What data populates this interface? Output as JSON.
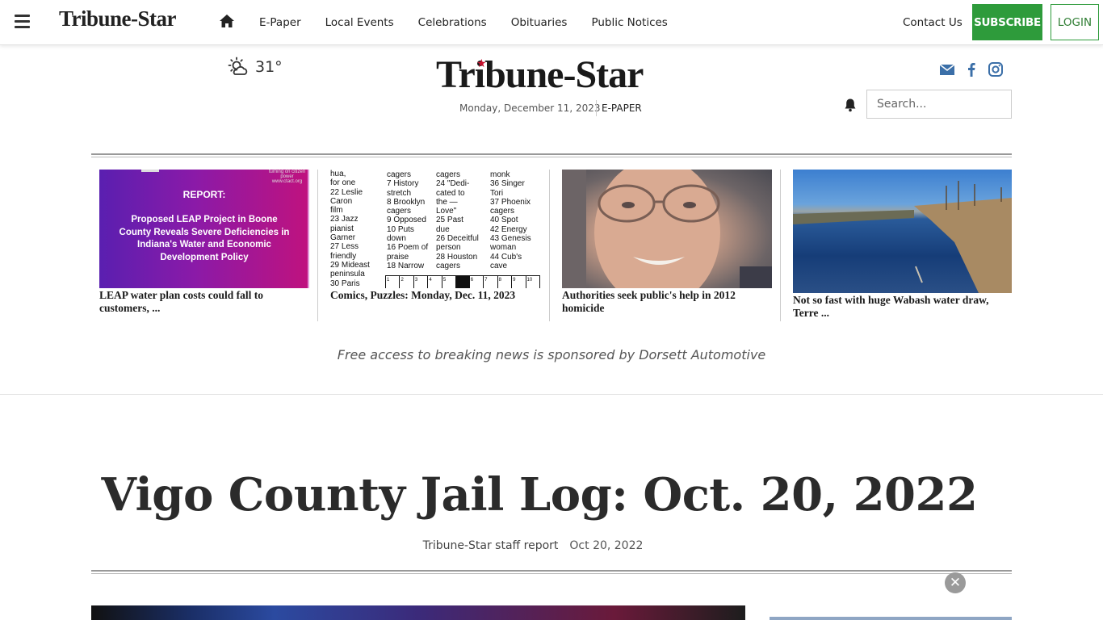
{
  "nav": {
    "logo": "Tribune-Star",
    "links": [
      "E-Paper",
      "Local Events",
      "Celebrations",
      "Obituaries",
      "Public Notices"
    ],
    "contact": "Contact Us",
    "subscribe": "SUBSCRIBE",
    "login": "LOGIN"
  },
  "masthead": {
    "temperature": "31°",
    "weather_icon": "partly-sunny-icon",
    "logo": "Tribune-Star",
    "date": "Monday, December 11, 2023",
    "epaper": "E-PAPER",
    "social_icons": [
      "envelope-icon",
      "facebook-icon",
      "instagram-icon"
    ],
    "search_placeholder": "Search..."
  },
  "headlines": [
    {
      "title": "LEAP water plan costs could fall to customers, ...",
      "image": {
        "url_text": "turning on citizen power   www.ctact.org",
        "heading": "REPORT:",
        "body": "Proposed LEAP Project in Boone County Reveals Severe Deficiencies in Indiana's Water and Economic Development Policy"
      }
    },
    {
      "title": "Comics, Puzzles: Monday, Dec. 11, 2023",
      "image": {
        "col1": [
          "hua,",
          "for one",
          "22 Leslie",
          "Caron",
          "film",
          "23 Jazz",
          "pianist",
          "Garner",
          "27 Less",
          "friendly",
          "29 Mideast",
          "peninsula",
          "30 Paris"
        ],
        "col2": [
          "cagers",
          "7 History",
          "stretch",
          "8 Brooklyn",
          "cagers",
          "9 Opposed",
          "10 Puts",
          "down",
          "16 Poem of",
          "praise",
          "18 Narrow"
        ],
        "col3": [
          "cagers",
          "24 \"Dedi-",
          "cated to",
          "the —",
          "Love\"",
          "25 Past",
          "due",
          "26 Deceitful",
          "person",
          "28 Houston",
          "cagers"
        ],
        "col4": [
          "monk",
          "36 Singer",
          "Tori",
          "37 Phoenix",
          "cagers",
          "40 Spot",
          "42 Energy",
          "43 Genesis",
          "woman",
          "44 Cub's",
          "cave"
        ],
        "grid_numbers": [
          "1",
          "2",
          "3",
          "4",
          "5",
          "",
          "6",
          "7",
          "8",
          "9",
          "10"
        ]
      }
    },
    {
      "title": "Authorities seek public's help in 2012 homicide"
    },
    {
      "title": "Not so fast with huge Wabash water draw, Terre ..."
    }
  ],
  "sponsor": "Free access to breaking news is sponsored by Dorsett Automotive",
  "article": {
    "title": "Vigo County Jail Log: Oct. 20, 2022",
    "author": "Tribune-Star staff report",
    "date": "Oct 20, 2022"
  },
  "colors": {
    "subscribe": "#2e9b3b",
    "logo_star": "#c8102e",
    "social": "#3b6fa8"
  }
}
